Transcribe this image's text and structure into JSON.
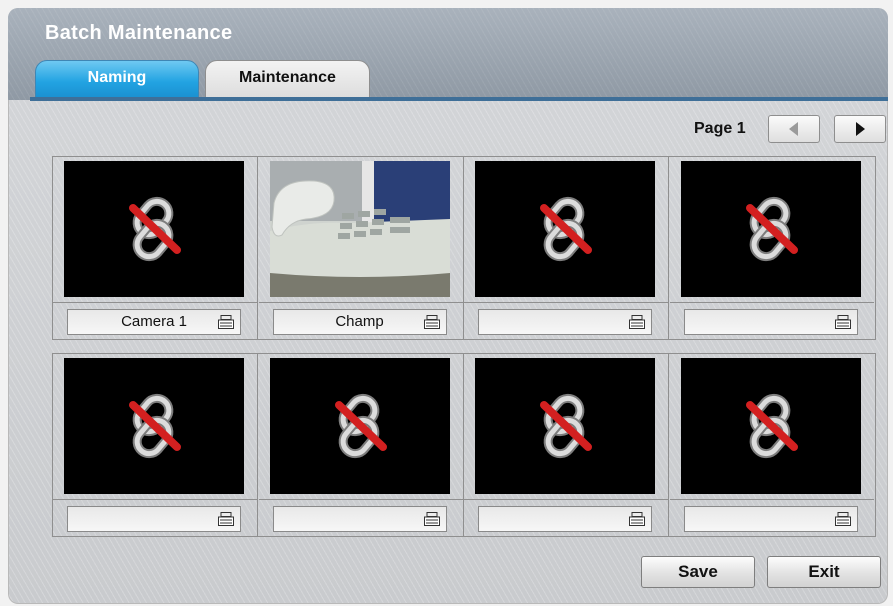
{
  "window": {
    "title": "Batch Maintenance"
  },
  "tabs": [
    {
      "label": "Naming",
      "active": true
    },
    {
      "label": "Maintenance",
      "active": false
    }
  ],
  "pager": {
    "label": "Page 1"
  },
  "cameras": [
    {
      "name": "Camera 1",
      "feed": "disconnected"
    },
    {
      "name": "Champ",
      "feed": "live"
    },
    {
      "name": "",
      "feed": "disconnected"
    },
    {
      "name": "",
      "feed": "disconnected"
    },
    {
      "name": "",
      "feed": "disconnected"
    },
    {
      "name": "",
      "feed": "disconnected"
    },
    {
      "name": "",
      "feed": "disconnected"
    },
    {
      "name": "",
      "feed": "disconnected"
    }
  ],
  "icons": {
    "disconnected": "broken-link-icon",
    "keyboard": "keyboard-icon",
    "prev": "triangle-left-icon",
    "next": "triangle-right-icon"
  },
  "buttons": {
    "save": "Save",
    "exit": "Exit"
  },
  "colors": {
    "active_tab": "#22a3e2",
    "disconnect_slash": "#d32020",
    "titlebar": "#9aa3ad"
  }
}
